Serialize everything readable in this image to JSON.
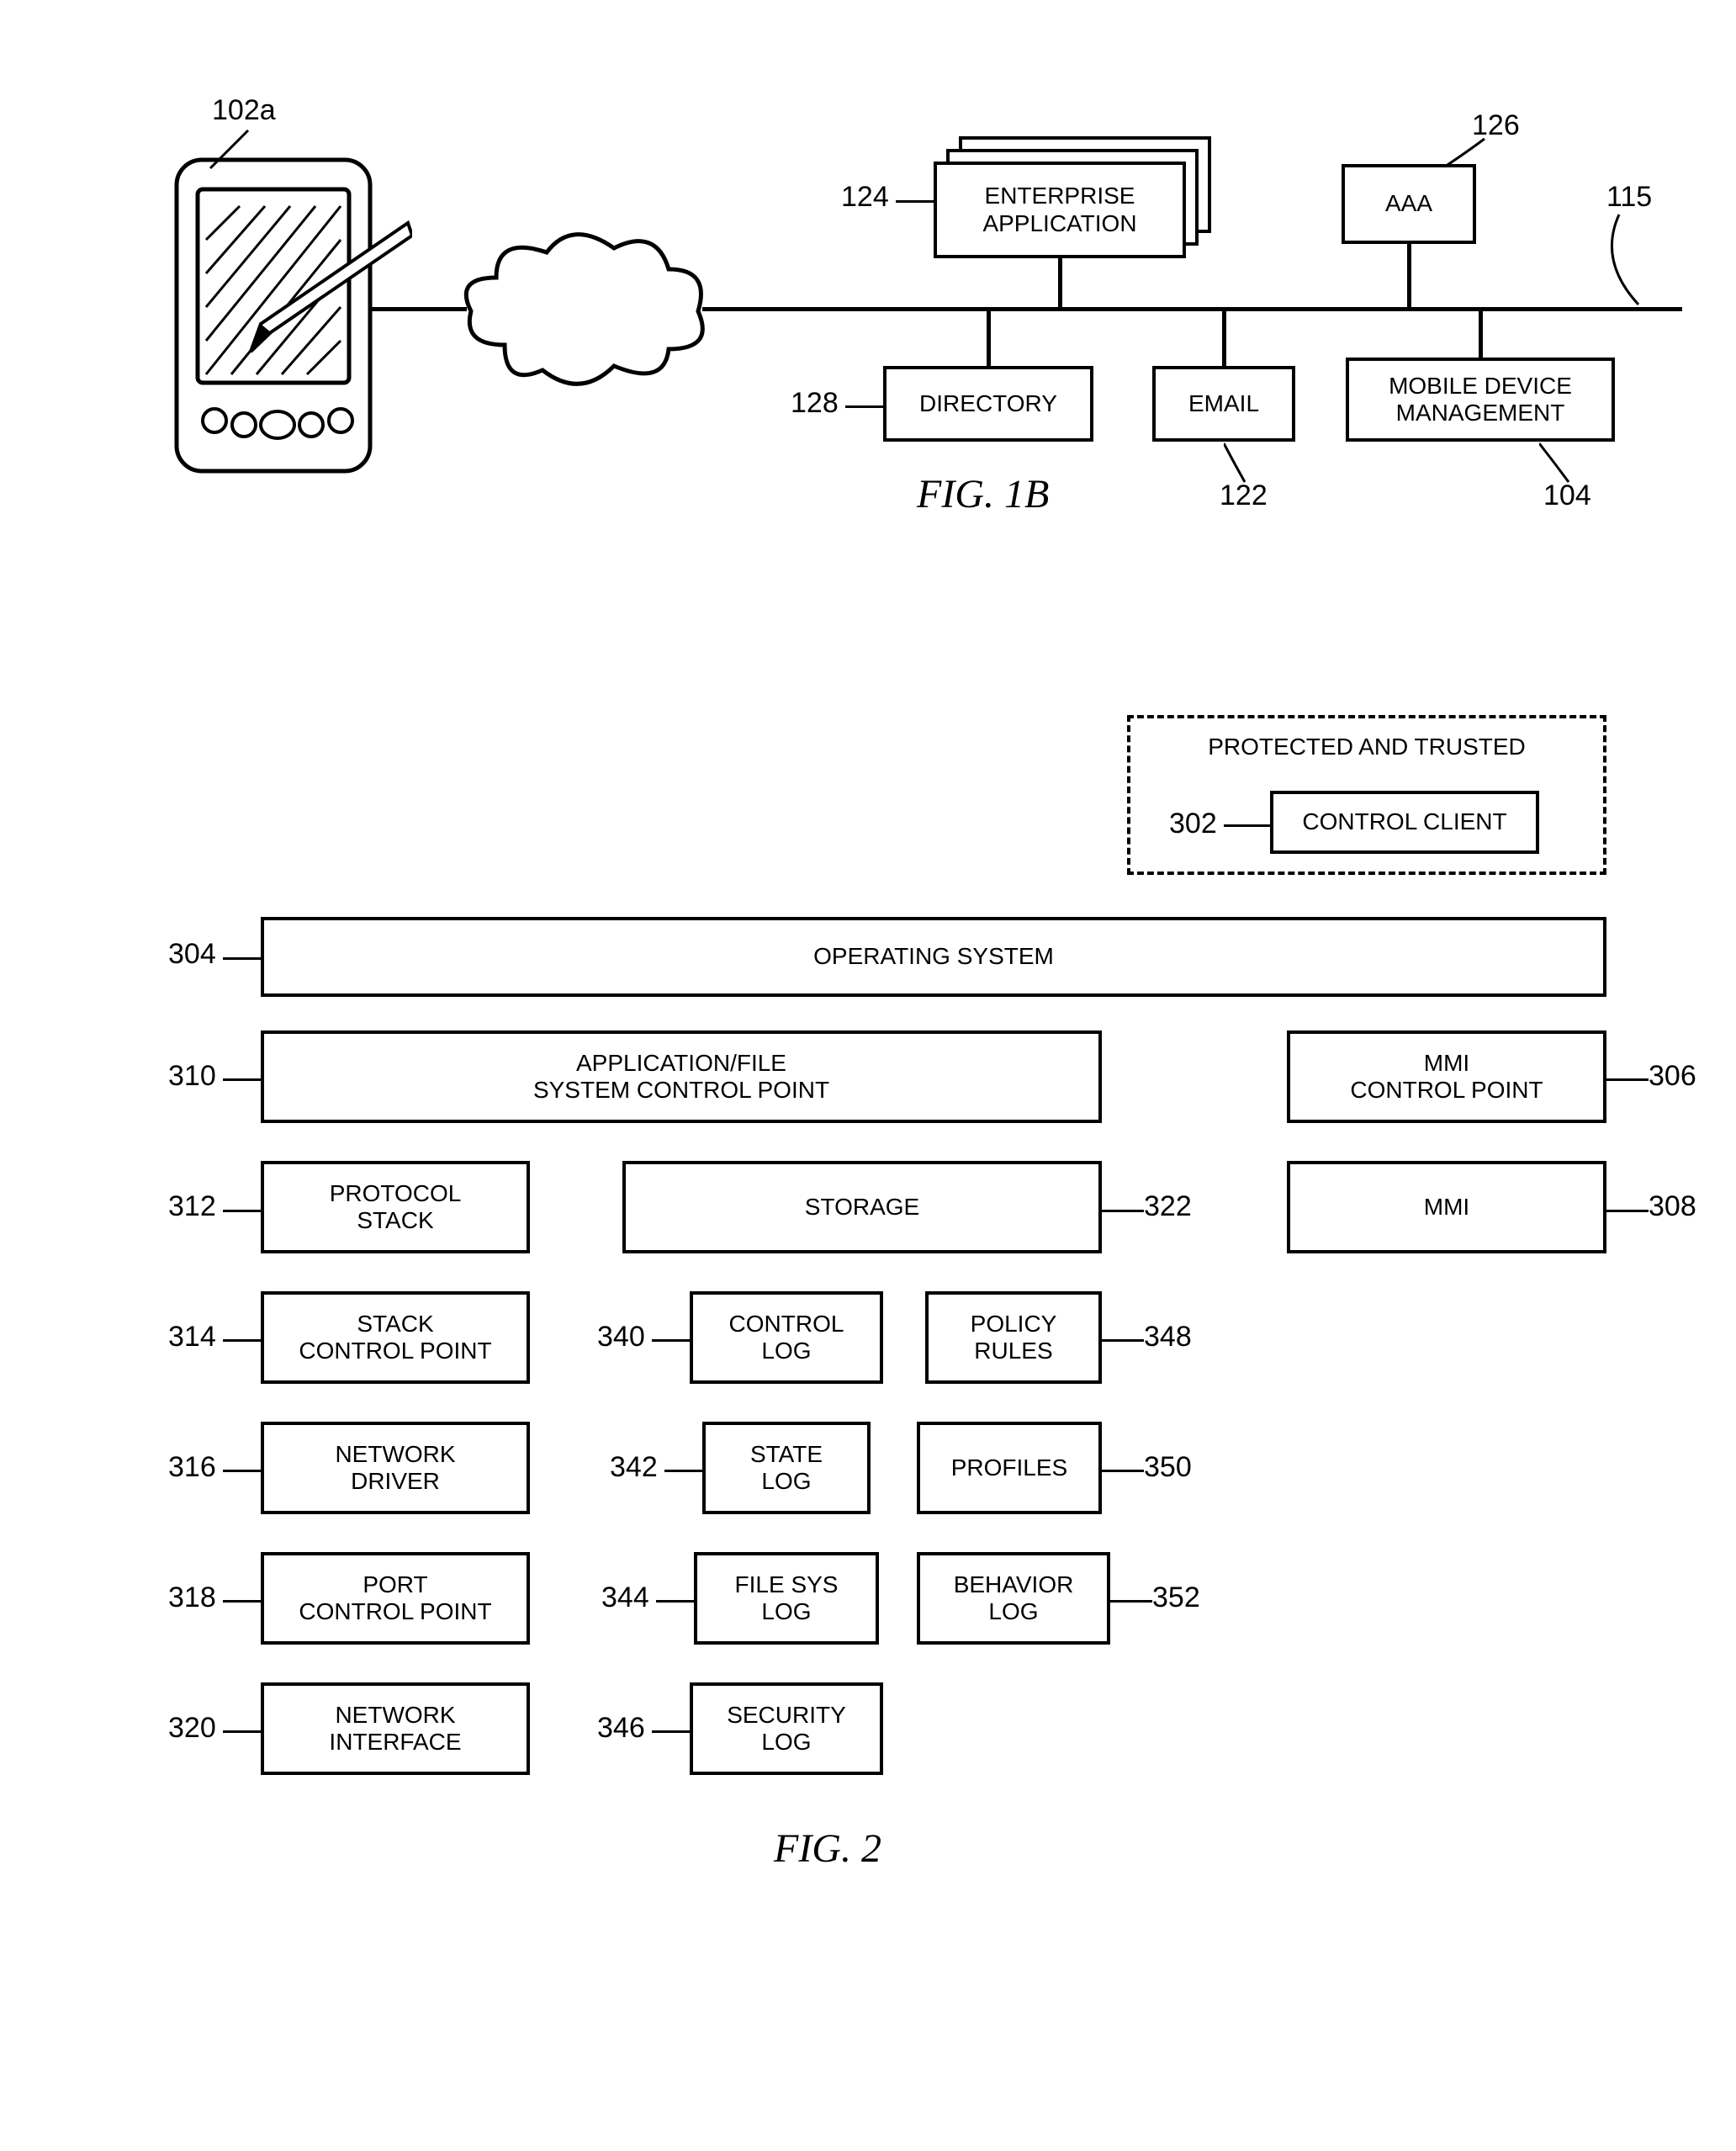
{
  "fig1b": {
    "refs": {
      "r102a": "102a",
      "r124": "124",
      "r126": "126",
      "r115": "115",
      "r128": "128",
      "r122": "122",
      "r104": "104"
    },
    "enterprise_app": "ENTERPRISE\nAPPLICATION",
    "aaa": "AAA",
    "directory": "DIRECTORY",
    "email": "EMAIL",
    "mdm": "MOBILE DEVICE\nMANAGEMENT",
    "fig_label": "FIG. 1B"
  },
  "fig2": {
    "refs": {
      "r302": "302",
      "r304": "304",
      "r310": "310",
      "r306": "306",
      "r312": "312",
      "r322": "322",
      "r308": "308",
      "r314": "314",
      "r340": "340",
      "r348": "348",
      "r316": "316",
      "r342": "342",
      "r350": "350",
      "r318": "318",
      "r344": "344",
      "r352": "352",
      "r320": "320",
      "r346": "346"
    },
    "protected_trusted": "PROTECTED AND TRUSTED",
    "control_client": "CONTROL CLIENT",
    "operating_system": "OPERATING SYSTEM",
    "app_file_cp": "APPLICATION/FILE\nSYSTEM CONTROL POINT",
    "mmi_cp": "MMI\nCONTROL POINT",
    "protocol_stack": "PROTOCOL\nSTACK",
    "storage": "STORAGE",
    "mmi": "MMI",
    "stack_cp": "STACK\nCONTROL POINT",
    "control_log": "CONTROL\nLOG",
    "policy_rules": "POLICY\nRULES",
    "network_driver": "NETWORK\nDRIVER",
    "state_log": "STATE\nLOG",
    "profiles": "PROFILES",
    "port_cp": "PORT\nCONTROL POINT",
    "file_sys_log": "FILE SYS\nLOG",
    "behavior_log": "BEHAVIOR\nLOG",
    "network_interface": "NETWORK\nINTERFACE",
    "security_log": "SECURITY\nLOG",
    "fig_label": "FIG. 2"
  }
}
